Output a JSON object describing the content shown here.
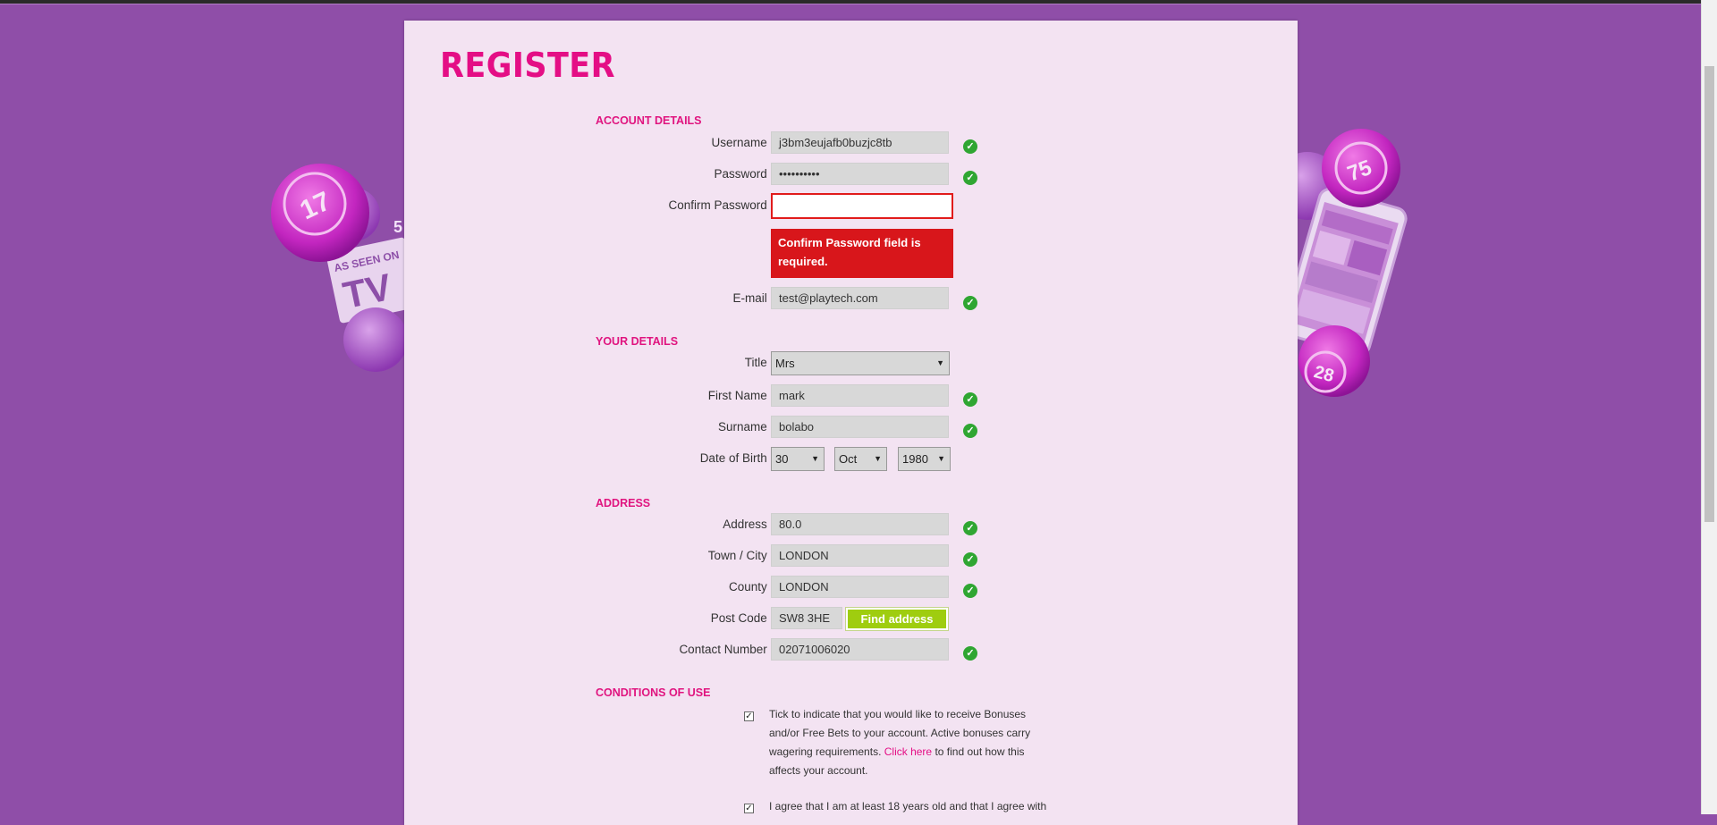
{
  "colors": {
    "background": "#8f4ea8",
    "panel": "#f3e3f2",
    "accent": "#e40e85",
    "error": "#d8161b",
    "success": "#2fa632",
    "button": "#9fcd0f"
  },
  "page": {
    "title": "REGISTER"
  },
  "sections": {
    "account": "ACCOUNT DETAILS",
    "your_details": "YOUR DETAILS",
    "address": "ADDRESS",
    "conditions": "CONDITIONS OF USE"
  },
  "required_mark": "*",
  "account": {
    "username": {
      "label": "Username",
      "value": "j3bm3eujafb0buzjc8tb",
      "valid": true
    },
    "password": {
      "label": "Password",
      "value": "••••••••••",
      "valid": true
    },
    "confirm_password": {
      "label": "Confirm Password",
      "value": "",
      "error": "Confirm Password field is required."
    },
    "email": {
      "label": "E-mail",
      "value": "test@playtech.com",
      "valid": true
    }
  },
  "details": {
    "title": {
      "label": "Title",
      "value": "Mrs"
    },
    "first_name": {
      "label": "First Name",
      "value": "mark",
      "valid": true
    },
    "surname": {
      "label": "Surname",
      "value": "bolabo",
      "valid": true
    },
    "dob": {
      "label": "Date of Birth",
      "day": "30",
      "month": "Oct",
      "year": "1980"
    }
  },
  "address": {
    "address": {
      "label": "Address",
      "value": "80.0",
      "valid": true
    },
    "town": {
      "label": "Town / City",
      "value": "LONDON",
      "valid": true
    },
    "county": {
      "label": "County",
      "value": "LONDON",
      "valid": true
    },
    "postcode": {
      "label": "Post Code",
      "value": "SW8 3HE"
    },
    "find_address": "Find address",
    "contact": {
      "label": "Contact Number",
      "value": "02071006020",
      "valid": true
    }
  },
  "conditions": {
    "bonus_text_1": "Tick to indicate that you would like to receive Bonuses and/or Free Bets to your account. Active bonuses carry wagering requirements.",
    "bonus_link": "Click here",
    "bonus_text_2": "to find out how this affects your account.",
    "bonus_checked": true,
    "age_text": "I agree that I am at least 18 years old and that I agree with",
    "age_checked": true
  },
  "icons": {
    "check": "valid-check-icon",
    "dropdown": "chevron-down-icon"
  },
  "decor": {
    "left_balls": [
      "17",
      "5"
    ],
    "left_tv_text": "AS SEEN ON TV",
    "right_balls": [
      "75",
      "28"
    ]
  }
}
